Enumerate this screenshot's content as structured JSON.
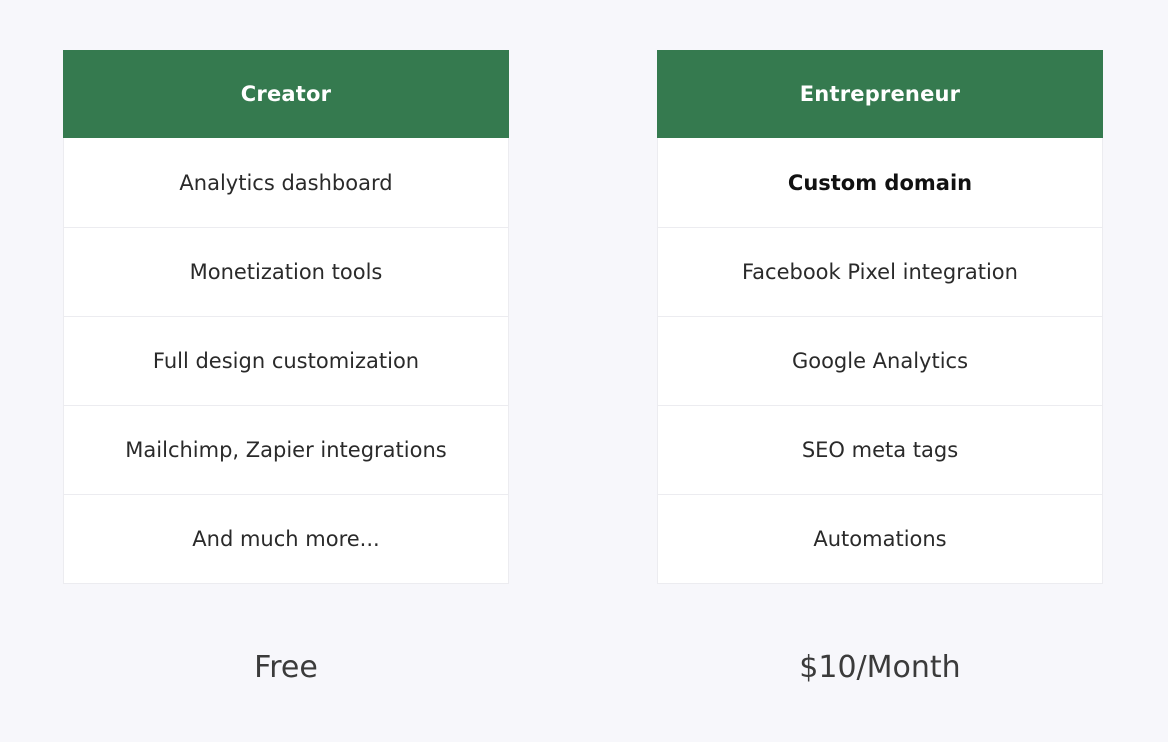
{
  "colors": {
    "background": "#f7f7fb",
    "header": "#357a4f",
    "card": "#ffffff",
    "border": "#ececf0"
  },
  "plans": [
    {
      "name": "Creator",
      "features": [
        "Analytics dashboard",
        "Monetization tools",
        "Full design customization",
        "Mailchimp, Zapier integrations",
        "And much more..."
      ],
      "price": "Free"
    },
    {
      "name": "Entrepreneur",
      "features": [
        "Custom domain",
        "Facebook Pixel integration",
        "Google Analytics",
        "SEO meta tags",
        "Automations"
      ],
      "price": "$10/Month"
    }
  ]
}
